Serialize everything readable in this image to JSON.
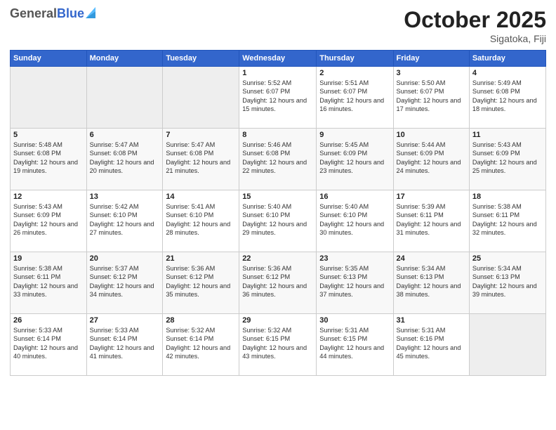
{
  "header": {
    "logo_general": "General",
    "logo_blue": "Blue",
    "month_title": "October 2025",
    "location": "Sigatoka, Fiji"
  },
  "days_of_week": [
    "Sunday",
    "Monday",
    "Tuesday",
    "Wednesday",
    "Thursday",
    "Friday",
    "Saturday"
  ],
  "weeks": [
    [
      {
        "day": "",
        "sunrise": "",
        "sunset": "",
        "daylight": ""
      },
      {
        "day": "",
        "sunrise": "",
        "sunset": "",
        "daylight": ""
      },
      {
        "day": "",
        "sunrise": "",
        "sunset": "",
        "daylight": ""
      },
      {
        "day": "1",
        "sunrise": "Sunrise: 5:52 AM",
        "sunset": "Sunset: 6:07 PM",
        "daylight": "Daylight: 12 hours and 15 minutes."
      },
      {
        "day": "2",
        "sunrise": "Sunrise: 5:51 AM",
        "sunset": "Sunset: 6:07 PM",
        "daylight": "Daylight: 12 hours and 16 minutes."
      },
      {
        "day": "3",
        "sunrise": "Sunrise: 5:50 AM",
        "sunset": "Sunset: 6:07 PM",
        "daylight": "Daylight: 12 hours and 17 minutes."
      },
      {
        "day": "4",
        "sunrise": "Sunrise: 5:49 AM",
        "sunset": "Sunset: 6:08 PM",
        "daylight": "Daylight: 12 hours and 18 minutes."
      }
    ],
    [
      {
        "day": "5",
        "sunrise": "Sunrise: 5:48 AM",
        "sunset": "Sunset: 6:08 PM",
        "daylight": "Daylight: 12 hours and 19 minutes."
      },
      {
        "day": "6",
        "sunrise": "Sunrise: 5:47 AM",
        "sunset": "Sunset: 6:08 PM",
        "daylight": "Daylight: 12 hours and 20 minutes."
      },
      {
        "day": "7",
        "sunrise": "Sunrise: 5:47 AM",
        "sunset": "Sunset: 6:08 PM",
        "daylight": "Daylight: 12 hours and 21 minutes."
      },
      {
        "day": "8",
        "sunrise": "Sunrise: 5:46 AM",
        "sunset": "Sunset: 6:08 PM",
        "daylight": "Daylight: 12 hours and 22 minutes."
      },
      {
        "day": "9",
        "sunrise": "Sunrise: 5:45 AM",
        "sunset": "Sunset: 6:09 PM",
        "daylight": "Daylight: 12 hours and 23 minutes."
      },
      {
        "day": "10",
        "sunrise": "Sunrise: 5:44 AM",
        "sunset": "Sunset: 6:09 PM",
        "daylight": "Daylight: 12 hours and 24 minutes."
      },
      {
        "day": "11",
        "sunrise": "Sunrise: 5:43 AM",
        "sunset": "Sunset: 6:09 PM",
        "daylight": "Daylight: 12 hours and 25 minutes."
      }
    ],
    [
      {
        "day": "12",
        "sunrise": "Sunrise: 5:43 AM",
        "sunset": "Sunset: 6:09 PM",
        "daylight": "Daylight: 12 hours and 26 minutes."
      },
      {
        "day": "13",
        "sunrise": "Sunrise: 5:42 AM",
        "sunset": "Sunset: 6:10 PM",
        "daylight": "Daylight: 12 hours and 27 minutes."
      },
      {
        "day": "14",
        "sunrise": "Sunrise: 5:41 AM",
        "sunset": "Sunset: 6:10 PM",
        "daylight": "Daylight: 12 hours and 28 minutes."
      },
      {
        "day": "15",
        "sunrise": "Sunrise: 5:40 AM",
        "sunset": "Sunset: 6:10 PM",
        "daylight": "Daylight: 12 hours and 29 minutes."
      },
      {
        "day": "16",
        "sunrise": "Sunrise: 5:40 AM",
        "sunset": "Sunset: 6:10 PM",
        "daylight": "Daylight: 12 hours and 30 minutes."
      },
      {
        "day": "17",
        "sunrise": "Sunrise: 5:39 AM",
        "sunset": "Sunset: 6:11 PM",
        "daylight": "Daylight: 12 hours and 31 minutes."
      },
      {
        "day": "18",
        "sunrise": "Sunrise: 5:38 AM",
        "sunset": "Sunset: 6:11 PM",
        "daylight": "Daylight: 12 hours and 32 minutes."
      }
    ],
    [
      {
        "day": "19",
        "sunrise": "Sunrise: 5:38 AM",
        "sunset": "Sunset: 6:11 PM",
        "daylight": "Daylight: 12 hours and 33 minutes."
      },
      {
        "day": "20",
        "sunrise": "Sunrise: 5:37 AM",
        "sunset": "Sunset: 6:12 PM",
        "daylight": "Daylight: 12 hours and 34 minutes."
      },
      {
        "day": "21",
        "sunrise": "Sunrise: 5:36 AM",
        "sunset": "Sunset: 6:12 PM",
        "daylight": "Daylight: 12 hours and 35 minutes."
      },
      {
        "day": "22",
        "sunrise": "Sunrise: 5:36 AM",
        "sunset": "Sunset: 6:12 PM",
        "daylight": "Daylight: 12 hours and 36 minutes."
      },
      {
        "day": "23",
        "sunrise": "Sunrise: 5:35 AM",
        "sunset": "Sunset: 6:13 PM",
        "daylight": "Daylight: 12 hours and 37 minutes."
      },
      {
        "day": "24",
        "sunrise": "Sunrise: 5:34 AM",
        "sunset": "Sunset: 6:13 PM",
        "daylight": "Daylight: 12 hours and 38 minutes."
      },
      {
        "day": "25",
        "sunrise": "Sunrise: 5:34 AM",
        "sunset": "Sunset: 6:13 PM",
        "daylight": "Daylight: 12 hours and 39 minutes."
      }
    ],
    [
      {
        "day": "26",
        "sunrise": "Sunrise: 5:33 AM",
        "sunset": "Sunset: 6:14 PM",
        "daylight": "Daylight: 12 hours and 40 minutes."
      },
      {
        "day": "27",
        "sunrise": "Sunrise: 5:33 AM",
        "sunset": "Sunset: 6:14 PM",
        "daylight": "Daylight: 12 hours and 41 minutes."
      },
      {
        "day": "28",
        "sunrise": "Sunrise: 5:32 AM",
        "sunset": "Sunset: 6:14 PM",
        "daylight": "Daylight: 12 hours and 42 minutes."
      },
      {
        "day": "29",
        "sunrise": "Sunrise: 5:32 AM",
        "sunset": "Sunset: 6:15 PM",
        "daylight": "Daylight: 12 hours and 43 minutes."
      },
      {
        "day": "30",
        "sunrise": "Sunrise: 5:31 AM",
        "sunset": "Sunset: 6:15 PM",
        "daylight": "Daylight: 12 hours and 44 minutes."
      },
      {
        "day": "31",
        "sunrise": "Sunrise: 5:31 AM",
        "sunset": "Sunset: 6:16 PM",
        "daylight": "Daylight: 12 hours and 45 minutes."
      },
      {
        "day": "",
        "sunrise": "",
        "sunset": "",
        "daylight": ""
      }
    ]
  ]
}
